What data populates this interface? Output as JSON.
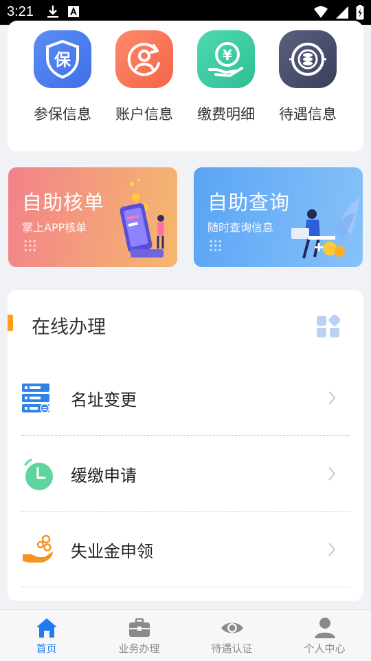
{
  "status_bar": {
    "time": "3:21"
  },
  "quick_menu": [
    {
      "label": "参保信息",
      "icon": "shield-bao-icon",
      "color": "#4b7cf0",
      "glyph": "保"
    },
    {
      "label": "账户信息",
      "icon": "account-user-icon",
      "color": "#fa7257"
    },
    {
      "label": "缴费明细",
      "icon": "payment-hand-coin-icon",
      "color": "#34c79e",
      "glyph": "¥"
    },
    {
      "label": "待遇信息",
      "icon": "benefit-coins-icon",
      "color": "#4a4f6d"
    }
  ],
  "banners": {
    "self_check": {
      "title": "自助核单",
      "subtitle": "掌上APP核单",
      "color_start": "#f2828a",
      "color_end": "#f5b86e"
    },
    "self_query": {
      "title": "自助查询",
      "subtitle": "随时查询信息",
      "color_start": "#5aa4f5",
      "color_end": "#87c2f8"
    }
  },
  "online": {
    "title": "在线办理",
    "accent": "#ff9d1c",
    "items": [
      {
        "label": "名址变更",
        "icon": "server-list-icon"
      },
      {
        "label": "缓缴申请",
        "icon": "clock-icon"
      },
      {
        "label": "失业金申领",
        "icon": "hand-coins-icon"
      }
    ]
  },
  "tabs": [
    {
      "label": "首页",
      "icon": "home-icon",
      "active": true
    },
    {
      "label": "业务办理",
      "icon": "briefcase-icon",
      "active": false
    },
    {
      "label": "待遇认证",
      "icon": "eye-icon",
      "active": false
    },
    {
      "label": "个人中心",
      "icon": "person-icon",
      "active": false
    }
  ],
  "colors": {
    "active_tab": "#1e7cf0",
    "inactive_tab": "#8a8a8a",
    "background": "#f1f2f6"
  }
}
